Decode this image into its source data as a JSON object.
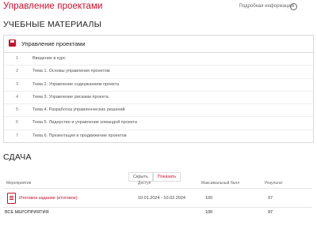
{
  "header": {
    "title": "Управление проектами",
    "top_link": "Подробная информация",
    "info_icon": "info-icon"
  },
  "materials": {
    "heading": "УЧЕБНЫЕ МАТЕРИАЛЫ",
    "panel_title": "Управление проектами",
    "panel_icon": "save-icon",
    "lessons": [
      {
        "num": "1",
        "text": "Введение в курс"
      },
      {
        "num": "2",
        "text": "Тема 1. Основы управления проектом"
      },
      {
        "num": "3",
        "text": "Тема 2. Управление содержанием проекта"
      },
      {
        "num": "4",
        "text": "Тема 3. Управление рисками проекта"
      },
      {
        "num": "5",
        "text": "Тема 4. Разработка управленческих решений"
      },
      {
        "num": "6",
        "text": "Тема 5. Лидерство и управление командой проекта"
      },
      {
        "num": "7",
        "text": "Тема 6. Презентация и продвижение проектов"
      }
    ]
  },
  "submission": {
    "heading": "СДАЧА",
    "filters": [
      "Скрыть",
      "Показать"
    ],
    "active_filter": "Показать",
    "columns": [
      "Мероприятия",
      "Доступ",
      "Максимальный балл",
      "Результат"
    ],
    "rows": [
      {
        "icon": "document-icon",
        "name": "Итоговое задание (итоговое)",
        "access": "10.01.2024 - 10.02.2024",
        "max": "100",
        "result": "97"
      }
    ],
    "total": {
      "label": "ВСЕ МЕРОПРИЯТИЯ",
      "max": "100",
      "result": "97"
    }
  },
  "colors": {
    "accent": "#c8102e"
  }
}
